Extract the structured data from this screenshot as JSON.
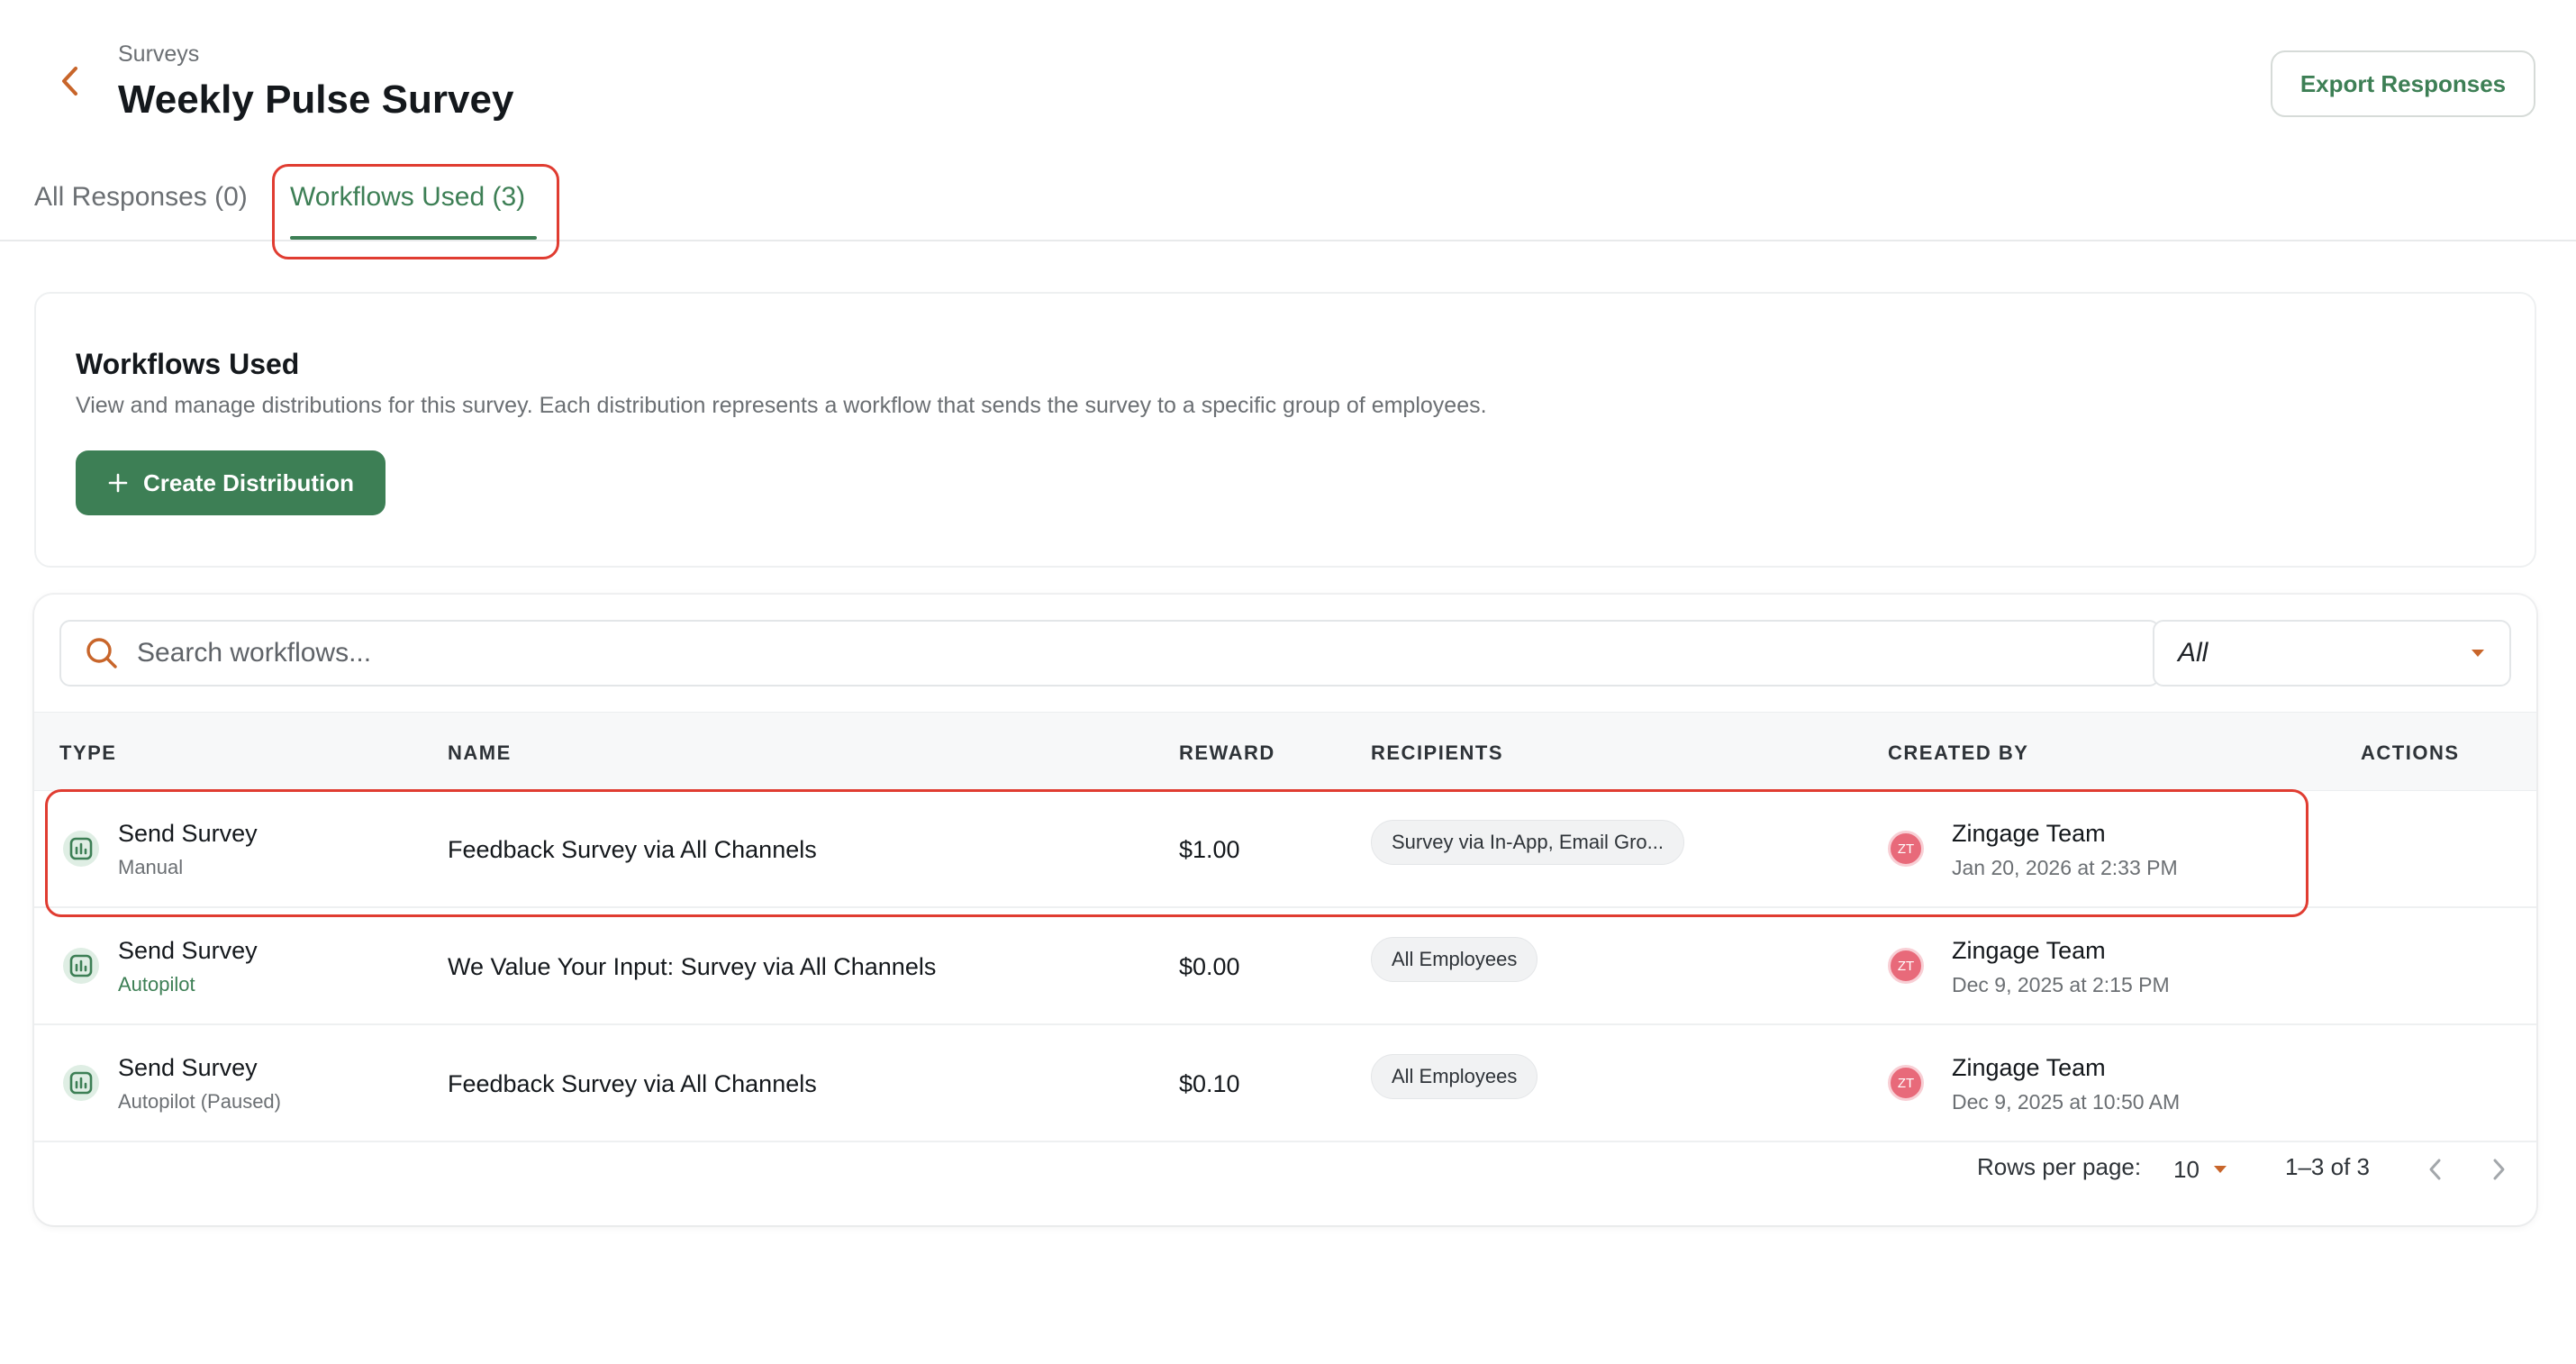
{
  "header": {
    "breadcrumb": "Surveys",
    "title": "Weekly Pulse Survey",
    "export_label": "Export Responses"
  },
  "tabs": [
    {
      "label": "All Responses (0)"
    },
    {
      "label": "Workflows Used (3)"
    }
  ],
  "card": {
    "title": "Workflows Used",
    "description": "View and manage distributions for this survey. Each distribution represents a workflow that sends the survey to a specific group of employees.",
    "create_label": "Create Distribution"
  },
  "search": {
    "placeholder": "Search workflows..."
  },
  "filter": {
    "value": "All"
  },
  "table": {
    "columns": [
      "TYPE",
      "NAME",
      "REWARD",
      "RECIPIENTS",
      "CREATED BY",
      "ACTIONS"
    ],
    "rows": [
      {
        "type": "Send Survey",
        "mode": "Manual",
        "name": "Feedback Survey via All Channels",
        "reward": "$1.00",
        "recipients": "Survey via In-App, Email Gro...",
        "initials": "ZT",
        "creator": "Zingage Team",
        "date": "Jan 20, 2026 at 2:33 PM"
      },
      {
        "type": "Send Survey",
        "mode": "Autopilot",
        "name": "We Value Your Input: Survey via All Channels",
        "reward": "$0.00",
        "recipients": "All Employees",
        "initials": "ZT",
        "creator": "Zingage Team",
        "date": "Dec 9, 2025 at 2:15 PM"
      },
      {
        "type": "Send Survey",
        "mode": "Autopilot (Paused)",
        "name": "Feedback Survey via All Channels",
        "reward": "$0.10",
        "recipients": "All Employees",
        "initials": "ZT",
        "creator": "Zingage Team",
        "date": "Dec 9, 2025 at 10:50 AM"
      }
    ]
  },
  "pagination": {
    "rows_label": "Rows per page:",
    "rows_value": "10",
    "range": "1–3 of 3"
  },
  "colors": {
    "accent": "#3d7f55",
    "highlight": "#e03c31",
    "icon_orange": "#c8652a",
    "avatar": "#e86a7a"
  },
  "icons": {
    "back": "chevron-left-icon",
    "search": "search-icon",
    "dropdown": "caret-down-icon",
    "plus": "plus-icon",
    "survey_type": "chart-icon",
    "prev": "chevron-left-icon",
    "next": "chevron-right-icon"
  }
}
